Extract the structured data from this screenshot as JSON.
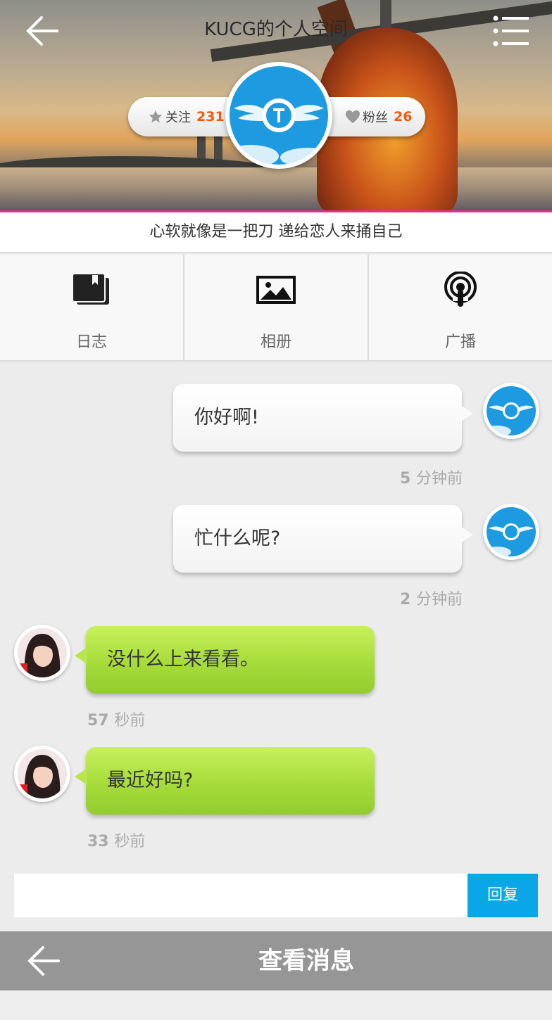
{
  "header": {
    "title": "KUCG的个人空间",
    "back_icon": "arrow-left-icon",
    "menu_icon": "list-menu-icon"
  },
  "profile": {
    "follow_label": "关注",
    "follow_count": "231",
    "fans_label": "粉丝",
    "fans_count": "26",
    "signature": "心软就像是一把刀 递给恋人来捅自己"
  },
  "tabs": [
    {
      "label": "日志",
      "icon": "book-icon"
    },
    {
      "label": "相册",
      "icon": "photo-icon"
    },
    {
      "label": "广播",
      "icon": "broadcast-icon"
    }
  ],
  "messages": [
    {
      "text": "你好啊!",
      "time_num": "5",
      "time_unit": "分钟前",
      "side": "out"
    },
    {
      "text": "忙什么呢?",
      "time_num": "2",
      "time_unit": "分钟前",
      "side": "out"
    },
    {
      "text": "没什么上来看看。",
      "time_num": "57",
      "time_unit": "秒前",
      "side": "in"
    },
    {
      "text": "最近好吗?",
      "time_num": "33",
      "time_unit": "秒前",
      "side": "in"
    }
  ],
  "reply": {
    "placeholder": "",
    "button_label": "回复"
  },
  "bottom_bar": {
    "title": "查看消息",
    "back_icon": "arrow-left-icon"
  },
  "colors": {
    "accent_pink": "#e6308a",
    "reply_blue": "#0aa7e8",
    "count_orange": "#f05a10",
    "bubble_green": "#a6dc3a"
  }
}
